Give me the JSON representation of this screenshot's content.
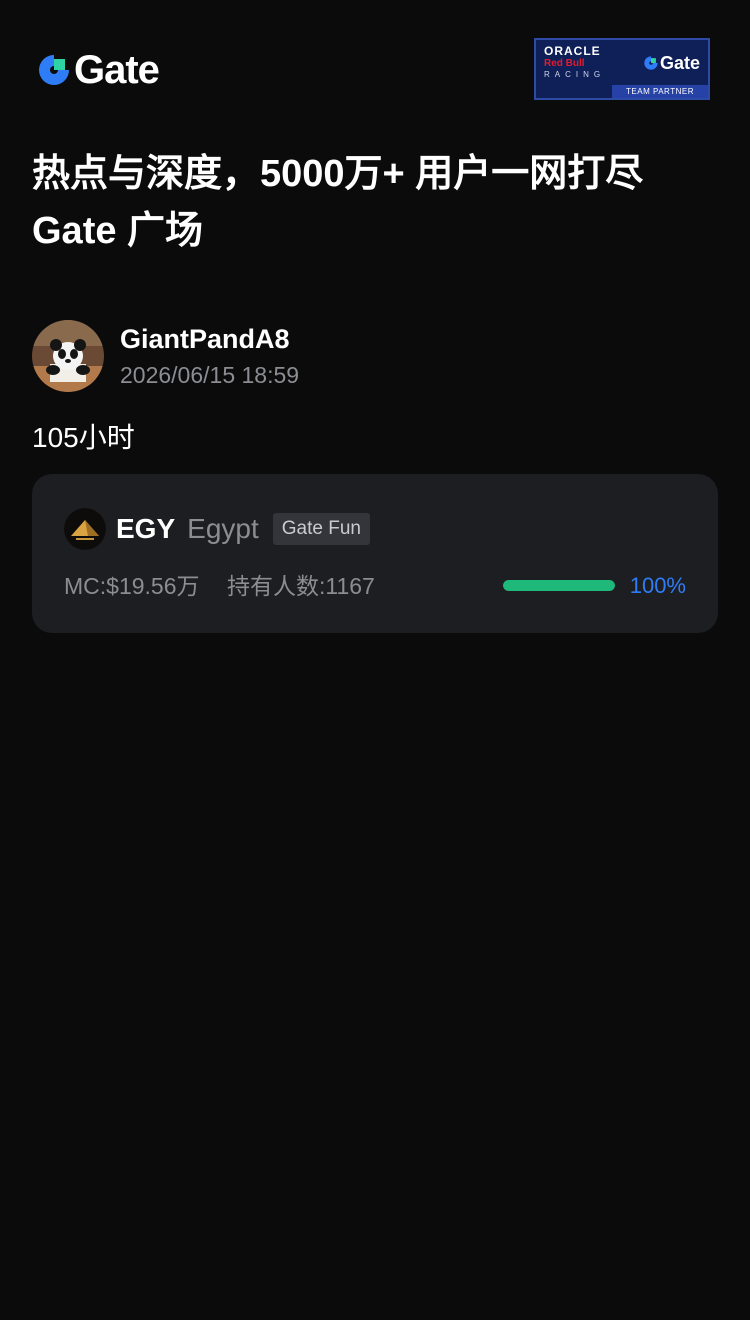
{
  "header": {
    "brand_name": "Gate",
    "partner": {
      "line1": "ORACLE",
      "line2": "Red Bull",
      "line3": "RACING",
      "brand": "Gate",
      "strip": "TEAM PARTNER"
    }
  },
  "headline": {
    "line1": "热点与深度，5000万+ 用户一网打尽",
    "line2": "Gate 广场"
  },
  "post": {
    "author": "GiantPandA8",
    "time": "2026/06/15 18:59",
    "text": "105小时"
  },
  "token": {
    "symbol": "EGY",
    "name": "Egypt",
    "tag": "Gate Fun",
    "mc": "MC:$19.56万",
    "holders": "持有人数:1167",
    "progress_percent": 100,
    "progress_label": "100%"
  },
  "colors": {
    "background": "#0b0b0c",
    "card": "#1d1e21",
    "brand_blue": "#2f7cf7",
    "progress_green": "#1eb97a",
    "muted_text": "#8b8d93"
  }
}
